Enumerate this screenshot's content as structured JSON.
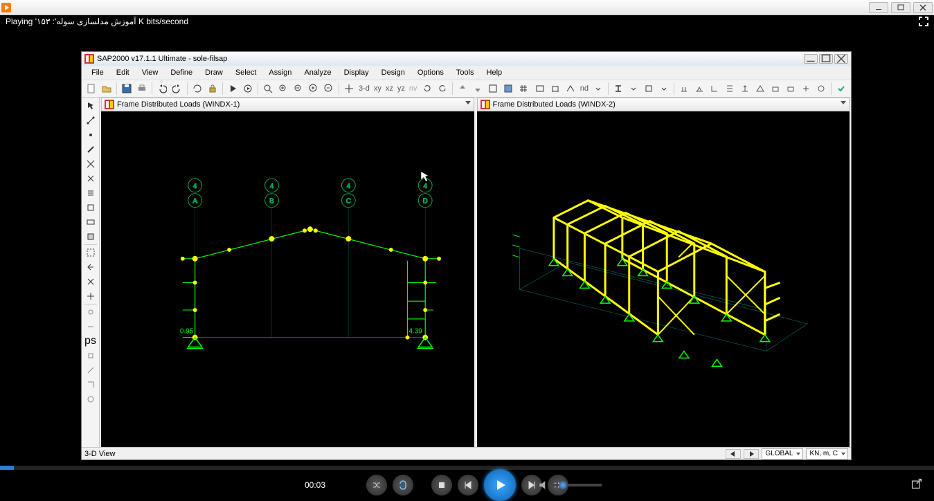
{
  "player": {
    "playing_label": "Playing 'آموزش مدلسازی سوله': ۱۵۳ K bits/second",
    "time": "00:03"
  },
  "sap": {
    "title": "SAP2000 v17.1.1 Ultimate - sole-filsap",
    "menus": [
      "File",
      "Edit",
      "View",
      "Define",
      "Draw",
      "Select",
      "Assign",
      "Analyze",
      "Display",
      "Design",
      "Options",
      "Tools",
      "Help"
    ],
    "toolbar_text": {
      "d3": "3-d",
      "xy": "xy",
      "xz": "xz",
      "yz": "yz",
      "nv": "nv",
      "nd": "nd"
    },
    "view_left_title": "Frame Distributed Loads (WINDX-1)",
    "view_right_title": "Frame Distributed Loads (WINDX-2)",
    "axis_labels_top": [
      "4",
      "4",
      "4",
      "4"
    ],
    "axis_labels_col": [
      "A",
      "B",
      "C",
      "D"
    ],
    "load_left": "0.95",
    "load_right": "4.39",
    "status_left": "3-D View",
    "status_combo1": "GLOBAL",
    "status_combo2": "KN, m, C"
  }
}
